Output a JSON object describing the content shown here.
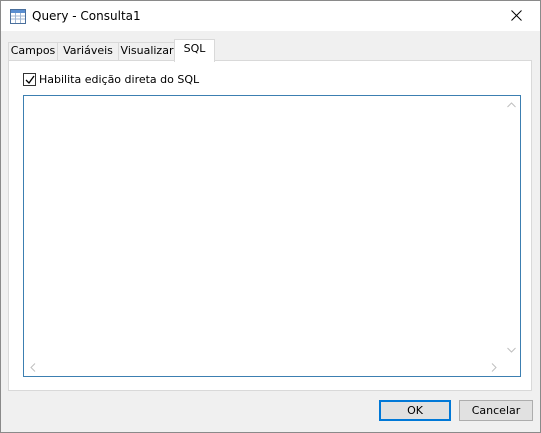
{
  "window": {
    "title": "Query - Consulta1",
    "icon": "query-window-icon"
  },
  "tabs": [
    {
      "label": "Campos",
      "active": false
    },
    {
      "label": "Variáveis",
      "active": false
    },
    {
      "label": "Visualizar",
      "active": false
    },
    {
      "label": "SQL",
      "active": true
    }
  ],
  "sql_tab": {
    "checkbox_label": "Habilita edição direta do SQL",
    "checkbox_checked": true,
    "sql_text": ""
  },
  "buttons": {
    "ok_label": "OK",
    "cancel_label": "Cancelar"
  },
  "colors": {
    "accent": "#0078d7",
    "editor_border": "#3c7fb1",
    "dialog_bg": "#f0f0f0"
  }
}
